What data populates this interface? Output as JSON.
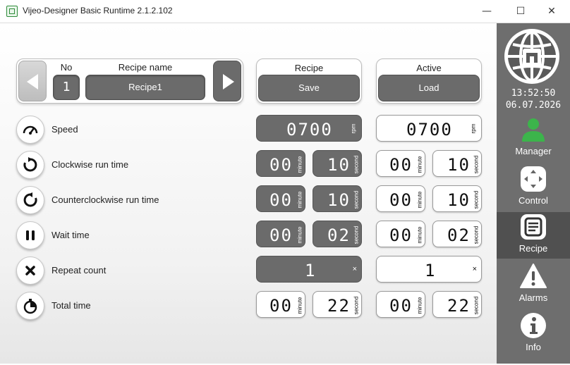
{
  "window": {
    "title": "Vijeo-Designer Basic Runtime 2.1.2.102",
    "minimize": "—",
    "maximize": "☐",
    "close": "✕"
  },
  "recipe_header": {
    "no_label": "No",
    "no_value": "1",
    "name_label": "Recipe name",
    "name_value": "Recipe1"
  },
  "recipe_save": {
    "label": "Recipe",
    "button": "Save"
  },
  "active_load": {
    "label": "Active",
    "button": "Load"
  },
  "rows": [
    {
      "label": "Speed",
      "icon": "speedometer-icon",
      "recipe": {
        "value": "0700",
        "unit": "rpm"
      },
      "active": {
        "value": "0700",
        "unit": "rpm"
      }
    },
    {
      "label": "Clockwise run time",
      "icon": "clockwise-icon",
      "recipe": {
        "min": "00",
        "sec": "10"
      },
      "active": {
        "min": "00",
        "sec": "10"
      }
    },
    {
      "label": "Counterclockwise run time",
      "icon": "counterclockwise-icon",
      "recipe": {
        "min": "00",
        "sec": "10"
      },
      "active": {
        "min": "00",
        "sec": "10"
      }
    },
    {
      "label": "Wait time",
      "icon": "pause-icon",
      "recipe": {
        "min": "00",
        "sec": "02"
      },
      "active": {
        "min": "00",
        "sec": "02"
      }
    },
    {
      "label": "Repeat count",
      "icon": "close-x-icon",
      "recipe": {
        "value": "1",
        "unit": "×"
      },
      "active": {
        "value": "1",
        "unit": "×"
      }
    },
    {
      "label": "Total time",
      "icon": "stopwatch-icon",
      "recipe": {
        "min": "00",
        "sec": "22"
      },
      "active": {
        "min": "00",
        "sec": "22"
      }
    }
  ],
  "units": {
    "minute": "minute",
    "second": "second"
  },
  "sidebar": {
    "time": "13:52:50",
    "date": "06.07.2026",
    "nav": [
      {
        "label": "Manager",
        "icon": "user-icon"
      },
      {
        "label": "Control",
        "icon": "dpad-icon"
      },
      {
        "label": "Recipe",
        "icon": "document-icon",
        "active": true
      },
      {
        "label": "Alarms",
        "icon": "warning-icon"
      },
      {
        "label": "Info",
        "icon": "info-icon"
      }
    ]
  },
  "colors": {
    "dark_field": "#6b6b6b",
    "sidebar": "#6e6e6e",
    "accent_green": "#3cb44b"
  }
}
